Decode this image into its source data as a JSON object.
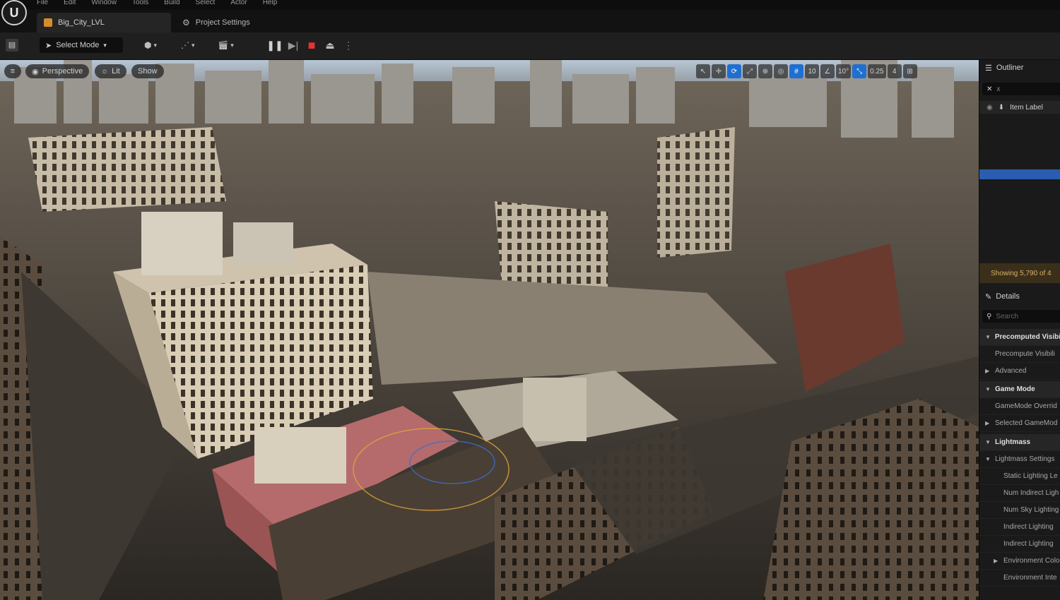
{
  "app": {
    "logo_glyph": "U",
    "menu": [
      "File",
      "Edit",
      "Window",
      "Tools",
      "Build",
      "Select",
      "Actor",
      "Help"
    ]
  },
  "tabs": [
    {
      "label": "Big_City_LVL",
      "active": true
    },
    {
      "label": "Project Settings",
      "active": false
    }
  ],
  "toolbar": {
    "save_icon": "save-icon",
    "select_mode_label": "Select Mode",
    "pause_glyph": "❚❚",
    "frame_skip_glyph": "▶|",
    "stop_glyph": "■",
    "eject_glyph": "⏏",
    "more_glyph": "⋮",
    "stop_color": "#e53333"
  },
  "viewport": {
    "perspective_label": "Perspective",
    "lit_label": "Lit",
    "show_label": "Show",
    "right_controls": [
      {
        "label": "↖",
        "blue": false
      },
      {
        "label": "✛",
        "blue": false
      },
      {
        "label": "⟳",
        "blue": true
      },
      {
        "label": "⤢",
        "blue": false
      },
      {
        "label": "⊕",
        "blue": false
      },
      {
        "label": "◎",
        "blue": false
      },
      {
        "label": "#",
        "blue": true
      },
      {
        "label": "10",
        "blue": false
      },
      {
        "label": "∠",
        "blue": false
      },
      {
        "label": "10°",
        "blue": false
      },
      {
        "label": "⤡",
        "blue": true
      },
      {
        "label": "0.25",
        "blue": false
      },
      {
        "label": "4",
        "blue": false
      },
      {
        "label": "⊞",
        "blue": false
      }
    ]
  },
  "outliner": {
    "title": "Outliner",
    "search_value": "x",
    "column_label": "Item Label",
    "status_text": "Showing 5,790 of 4"
  },
  "details": {
    "title": "Details",
    "search_placeholder": "Search",
    "rows": [
      {
        "label": "Precomputed Visibi",
        "type": "cat"
      },
      {
        "label": "Precompute Visibili",
        "type": "sub"
      },
      {
        "label": "Advanced",
        "type": "sub",
        "arrow": "▶"
      },
      {
        "label": "Game Mode",
        "type": "cat"
      },
      {
        "label": "GameMode Overrid",
        "type": "sub"
      },
      {
        "label": "Selected GameMod",
        "type": "sub",
        "arrow": "▶"
      },
      {
        "label": "Lightmass",
        "type": "cat"
      },
      {
        "label": "Lightmass Settings",
        "type": "sub",
        "arrow": "▼"
      },
      {
        "label": "Static Lighting Le",
        "type": "prop"
      },
      {
        "label": "Num Indirect Ligh",
        "type": "prop"
      },
      {
        "label": "Num Sky Lighting",
        "type": "prop"
      },
      {
        "label": "Indirect Lighting",
        "type": "prop"
      },
      {
        "label": "Indirect Lighting",
        "type": "prop"
      },
      {
        "label": "Environment Colo",
        "type": "prop",
        "arrow": "▶"
      },
      {
        "label": "Environment Inte",
        "type": "prop"
      }
    ]
  }
}
